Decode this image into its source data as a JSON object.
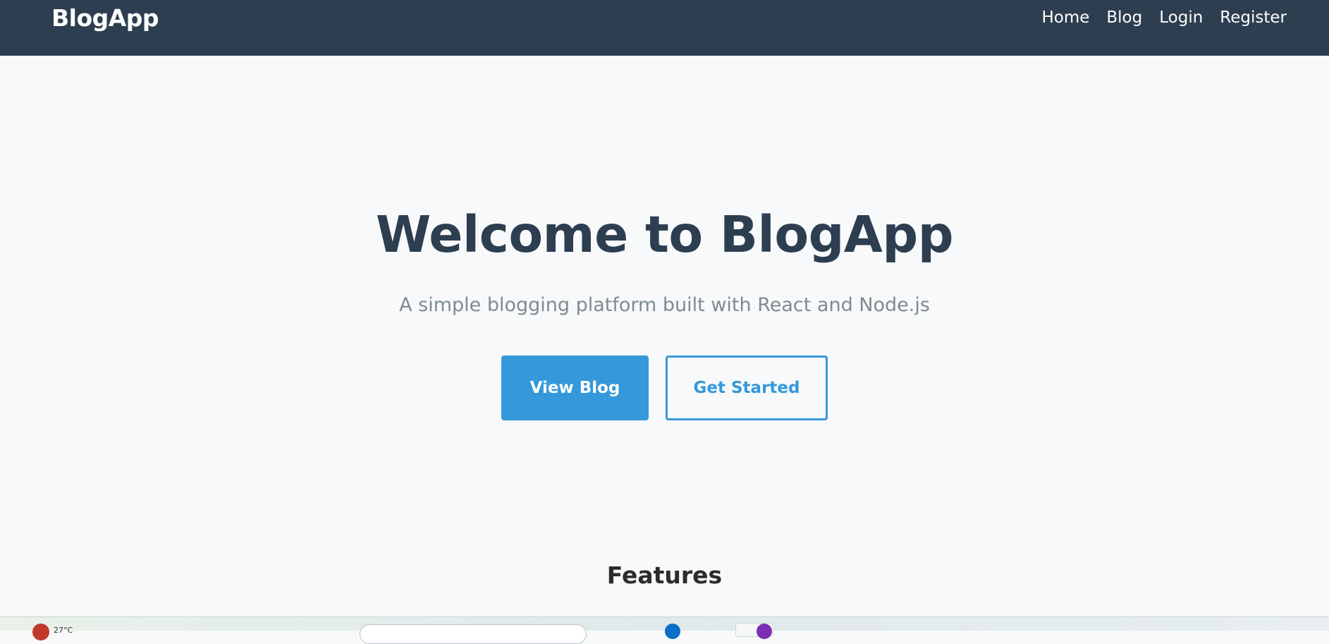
{
  "navbar": {
    "brand": "BlogApp",
    "links": [
      "Home",
      "Blog",
      "Login",
      "Register"
    ]
  },
  "hero": {
    "title": "Welcome to BlogApp",
    "subtitle": "A simple blogging platform built with React and Node.js",
    "primary_button": "View Blog",
    "secondary_button": "Get Started"
  },
  "features": {
    "title": "Features"
  },
  "taskbar": {
    "weather_text": "27°C",
    "weather_badge_color": "#c0392b",
    "app_badge_colors": [
      "#0b6fc9",
      "#7b2fb3"
    ]
  },
  "colors": {
    "navbar_bg": "#2c3e50",
    "accent": "#3498db",
    "page_bg": "#f7f9fa",
    "title_text": "#2c3e50",
    "subtitle_text": "#7f8c8d"
  }
}
